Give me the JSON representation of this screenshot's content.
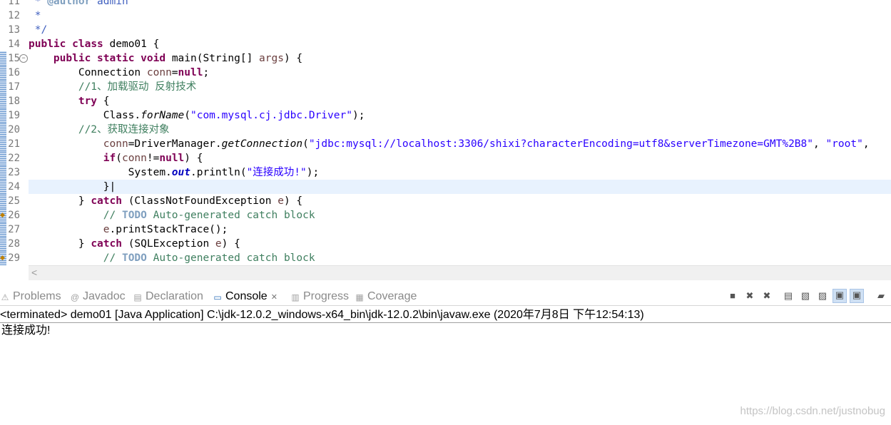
{
  "editor": {
    "lines": [
      {
        "num": "11",
        "tokens": [
          {
            "t": " * ",
            "c": "jd"
          },
          {
            "t": "@author",
            "c": "jdtag"
          },
          {
            "t": " admin",
            "c": "jd"
          }
        ]
      },
      {
        "num": "12",
        "tokens": [
          {
            "t": " *",
            "c": "jd"
          }
        ]
      },
      {
        "num": "13",
        "tokens": [
          {
            "t": " */",
            "c": "jd"
          }
        ]
      },
      {
        "num": "14",
        "tokens": [
          {
            "t": "public",
            "c": "kw"
          },
          {
            "t": " "
          },
          {
            "t": "class",
            "c": "kw"
          },
          {
            "t": " demo01 {"
          }
        ]
      },
      {
        "num": "15",
        "tokens": [
          {
            "t": "    "
          },
          {
            "t": "public",
            "c": "kw"
          },
          {
            "t": " "
          },
          {
            "t": "static",
            "c": "kw"
          },
          {
            "t": " "
          },
          {
            "t": "void",
            "c": "kw"
          },
          {
            "t": " main(String[] "
          },
          {
            "t": "args",
            "c": "var"
          },
          {
            "t": ") {"
          }
        ]
      },
      {
        "num": "16",
        "tokens": [
          {
            "t": "        Connection "
          },
          {
            "t": "conn",
            "c": "var"
          },
          {
            "t": "="
          },
          {
            "t": "null",
            "c": "kw"
          },
          {
            "t": ";"
          }
        ]
      },
      {
        "num": "17",
        "tokens": [
          {
            "t": "        "
          },
          {
            "t": "//1、加载驱动 反射技术",
            "c": "cm"
          }
        ]
      },
      {
        "num": "18",
        "tokens": [
          {
            "t": "        "
          },
          {
            "t": "try",
            "c": "kw"
          },
          {
            "t": " {"
          }
        ]
      },
      {
        "num": "19",
        "tokens": [
          {
            "t": "            Class."
          },
          {
            "t": "forName",
            "c": "it"
          },
          {
            "t": "("
          },
          {
            "t": "\"com.mysql.cj.jdbc.Driver\"",
            "c": "str"
          },
          {
            "t": ");"
          }
        ]
      },
      {
        "num": "20",
        "tokens": [
          {
            "t": "        "
          },
          {
            "t": "//2、获取连接对象",
            "c": "cm"
          }
        ]
      },
      {
        "num": "21",
        "tokens": [
          {
            "t": "            "
          },
          {
            "t": "conn",
            "c": "var"
          },
          {
            "t": "=DriverManager."
          },
          {
            "t": "getConnection",
            "c": "it"
          },
          {
            "t": "("
          },
          {
            "t": "\"jdbc:mysql://localhost:3306/shixi?characterEncoding=utf8&serverTimezone=GMT%2B8\"",
            "c": "str"
          },
          {
            "t": ", "
          },
          {
            "t": "\"root\"",
            "c": "str"
          },
          {
            "t": ", "
          }
        ]
      },
      {
        "num": "22",
        "tokens": [
          {
            "t": "            "
          },
          {
            "t": "if",
            "c": "kw"
          },
          {
            "t": "("
          },
          {
            "t": "conn",
            "c": "var"
          },
          {
            "t": "!="
          },
          {
            "t": "null",
            "c": "kw"
          },
          {
            "t": ") {"
          }
        ]
      },
      {
        "num": "23",
        "tokens": [
          {
            "t": "                System."
          },
          {
            "t": "out",
            "c": "fld"
          },
          {
            "t": ".println("
          },
          {
            "t": "\"连接成功!\"",
            "c": "str"
          },
          {
            "t": ");"
          }
        ]
      },
      {
        "num": "24",
        "tokens": [
          {
            "t": "            }|"
          }
        ]
      },
      {
        "num": "25",
        "tokens": [
          {
            "t": "        } "
          },
          {
            "t": "catch",
            "c": "kw"
          },
          {
            "t": " (ClassNotFoundException "
          },
          {
            "t": "e",
            "c": "var"
          },
          {
            "t": ") {"
          }
        ]
      },
      {
        "num": "26",
        "tokens": [
          {
            "t": "            "
          },
          {
            "t": "// ",
            "c": "cm"
          },
          {
            "t": "TODO",
            "c": "todo"
          },
          {
            "t": " Auto-generated catch block",
            "c": "cm"
          }
        ]
      },
      {
        "num": "27",
        "tokens": [
          {
            "t": "            "
          },
          {
            "t": "e",
            "c": "var"
          },
          {
            "t": ".printStackTrace();"
          }
        ]
      },
      {
        "num": "28",
        "tokens": [
          {
            "t": "        } "
          },
          {
            "t": "catch",
            "c": "kw"
          },
          {
            "t": " (SQLException "
          },
          {
            "t": "e",
            "c": "var"
          },
          {
            "t": ") {"
          }
        ]
      },
      {
        "num": "29",
        "tokens": [
          {
            "t": "            "
          },
          {
            "t": "// ",
            "c": "cm"
          },
          {
            "t": "TODO",
            "c": "todo"
          },
          {
            "t": " Auto-generated catch block",
            "c": "cm"
          }
        ]
      }
    ],
    "current_line": "24",
    "fold_line": "15",
    "scroll_left_glyph": "<"
  },
  "views": {
    "tabs": [
      {
        "label": "Problems",
        "icon": "problems-icon",
        "glyph": "⚠"
      },
      {
        "label": "Javadoc",
        "icon": "javadoc-icon",
        "glyph": "@"
      },
      {
        "label": "Declaration",
        "icon": "declaration-icon",
        "glyph": "▤"
      },
      {
        "label": "Console",
        "icon": "console-icon",
        "glyph": "▭",
        "active": true,
        "close": "✕"
      },
      {
        "label": "Progress",
        "icon": "progress-icon",
        "glyph": "▥"
      },
      {
        "label": "Coverage",
        "icon": "coverage-icon",
        "glyph": "▦"
      }
    ]
  },
  "console": {
    "status": "<terminated> demo01 [Java Application] C:\\jdk-12.0.2_windows-x64_bin\\jdk-12.0.2\\bin\\javaw.exe (2020年7月8日 下午12:54:13)",
    "output": "连接成功!"
  },
  "watermark": "https://blog.csdn.net/justnobug"
}
